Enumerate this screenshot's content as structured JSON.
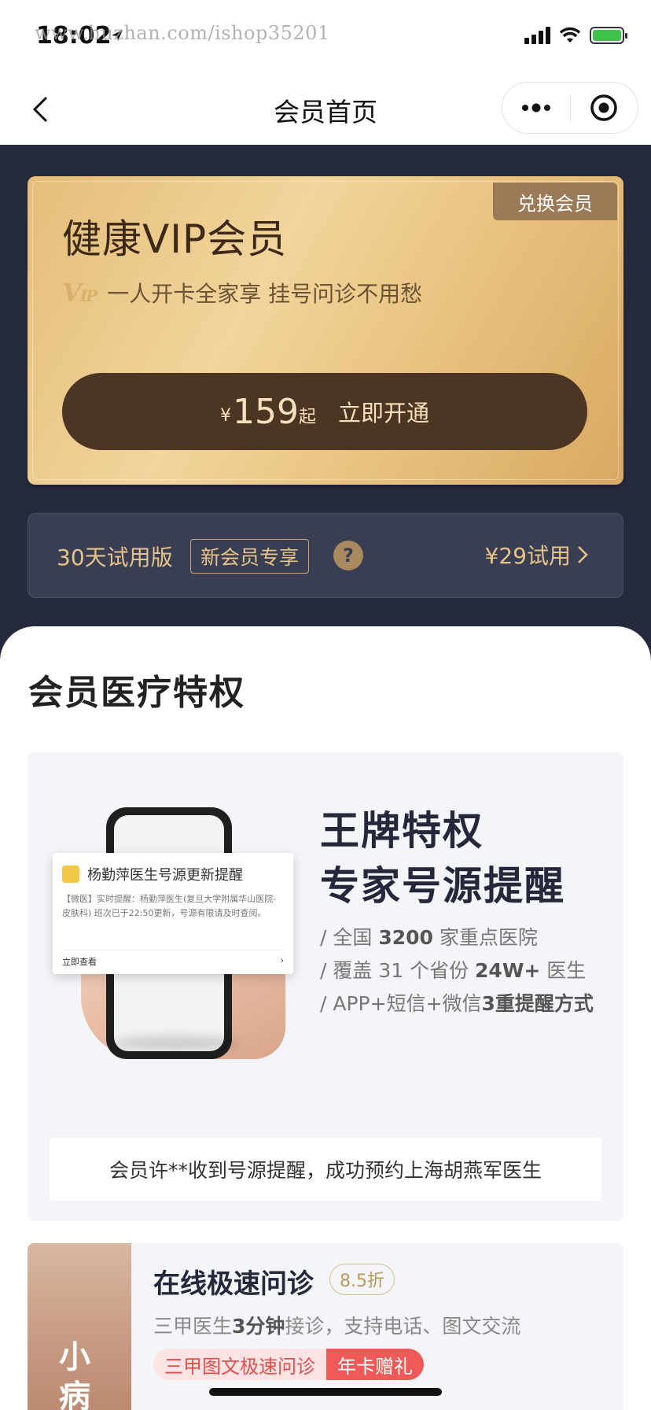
{
  "status_bar": {
    "time": "18:02",
    "watermark": "www.huzhan.com/ishop35201"
  },
  "nav": {
    "title": "会员首页"
  },
  "vip_card": {
    "exchange_label": "兑换会员",
    "title": "健康VIP会员",
    "logo_text": "V",
    "logo_small": "IP",
    "subtitle": "一人开卡全家享 挂号问诊不用愁",
    "button": {
      "currency": "¥",
      "price": "159",
      "suffix": "起",
      "action": "立即开通"
    }
  },
  "trial": {
    "label": "30天试用版",
    "tag": "新会员专享",
    "help": "?",
    "price": "¥29试用"
  },
  "section": {
    "title": "会员医疗特权"
  },
  "privilege": {
    "notification": {
      "title": "杨勤萍医生号源更新提醒",
      "body": "【微医】实时提醒：杨勤萍医生(复旦大学附属华山医院-皮肤科) 班次已于22:50更新，号源有限请及时查阅。",
      "action": "立即查看"
    },
    "headline1": "王牌特权",
    "headline2": "专家号源提醒",
    "features": [
      {
        "prefix": "/ 全国 ",
        "bold": "3200",
        "suffix": " 家重点医院"
      },
      {
        "prefix": "/ 覆盖 31 个省份 ",
        "bold": "24W+",
        "suffix": " 医生"
      },
      {
        "prefix": "/ APP+短信+微信",
        "bold": "3重提醒方式",
        "suffix": ""
      }
    ],
    "testimonial": "会员许**收到号源提醒，成功预约上海胡燕军医生"
  },
  "consult": {
    "image_text": "小病",
    "title": "在线极速问诊",
    "discount": "8.5折",
    "desc_prefix": "三甲医生",
    "desc_bold": "3分钟",
    "desc_suffix": "接诊，支持电话、图文交流",
    "tag_service": "三甲图文极速问诊",
    "tag_gift": "年卡赠礼"
  },
  "colors": {
    "page_bg": "#262a3d",
    "gold": "#e6c38a",
    "vip_button": "#4c3523",
    "red_tag": "#ef5a58"
  }
}
